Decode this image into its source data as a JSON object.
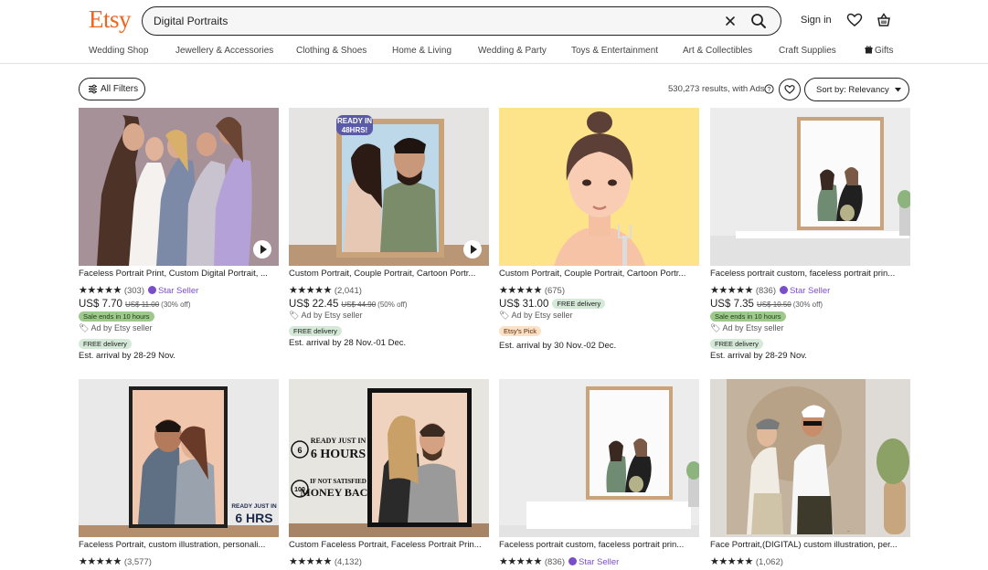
{
  "header": {
    "logo": "Etsy",
    "search_value": "Digital Portraits",
    "sign_in": "Sign in",
    "icons": [
      "close-icon",
      "search-icon",
      "heart-icon",
      "basket-icon"
    ],
    "accent_color": "#f1641e"
  },
  "categories": [
    "Wedding Shop",
    "Jewellery & Accessories",
    "Clothing & Shoes",
    "Home & Living",
    "Wedding & Party",
    "Toys & Entertainment",
    "Art & Collectibles",
    "Craft Supplies",
    "Gifts"
  ],
  "toolbar": {
    "all_filters": "All Filters",
    "results": "530,273 results, with Ads",
    "sort_label": "Sort by: Relevancy"
  },
  "listings": [
    {
      "title": "Faceless Portrait Print, Custom Digital Portrait, ...",
      "stars": "★★★★★",
      "reviews": "(303)",
      "star_seller": "Star Seller",
      "price": "US$ 7.70",
      "original_price": "US$ 11.00",
      "discount": "(30% off)",
      "badge": "Sale ends in 10 hours",
      "ad": "Ad by Etsy seller",
      "free_delivery": "FREE delivery",
      "arrival": "Est. arrival by 28-29 Nov."
    },
    {
      "title": "Custom Portrait, Couple Portrait, Cartoon Portr...",
      "stars": "★★★★★",
      "reviews": "(2,041)",
      "price": "US$ 22.45",
      "original_price": "US$ 44.90",
      "discount": "(50% off)",
      "image_label": "READY IN 48HRS!",
      "ad": "Ad by Etsy seller",
      "free_delivery": "FREE delivery",
      "arrival": "Est. arrival by 28 Nov.-01 Dec."
    },
    {
      "title": "Custom Portrait, Couple Portrait, Cartoon Portr...",
      "stars": "★★★★★",
      "reviews": "(675)",
      "price": "US$ 31.00",
      "free_pill": "FREE delivery",
      "ad": "Ad by Etsy seller",
      "pick": "Etsy's Pick",
      "arrival": "Est. arrival by 30 Nov.-02 Dec."
    },
    {
      "title": "Faceless portrait custom, faceless portrait prin...",
      "stars": "★★★★★",
      "reviews": "(836)",
      "star_seller": "Star Seller",
      "price": "US$ 7.35",
      "original_price": "US$ 10.50",
      "discount": "(30% off)",
      "badge": "Sale ends in 10 hours",
      "ad": "Ad by Etsy seller",
      "free_delivery": "FREE delivery",
      "arrival": "Est. arrival by 28-29 Nov."
    },
    {
      "title": "Faceless Portrait, custom illustration, personali...",
      "stars": "★★★★★",
      "reviews": "(3,577)",
      "image_label_top": "READY JUST IN",
      "image_label_big": "6 HRS"
    },
    {
      "title": "Custom Faceless Portrait, Faceless Portrait Prin...",
      "stars": "★★★★★",
      "reviews": "(4,132)",
      "image_label_1": "READY JUST IN",
      "image_label_2": "6 HOURS",
      "image_label_3": "IF NOT SATISFIED",
      "image_label_4": "MONEY BACK"
    },
    {
      "title": "Faceless portrait custom, faceless portrait prin...",
      "stars": "★★★★★",
      "reviews": "(836)",
      "star_seller": "Star Seller"
    },
    {
      "title": "Face Portrait,(DIGITAL) custom illustration, per...",
      "stars": "★★★★★",
      "reviews": "(1,062)"
    }
  ]
}
